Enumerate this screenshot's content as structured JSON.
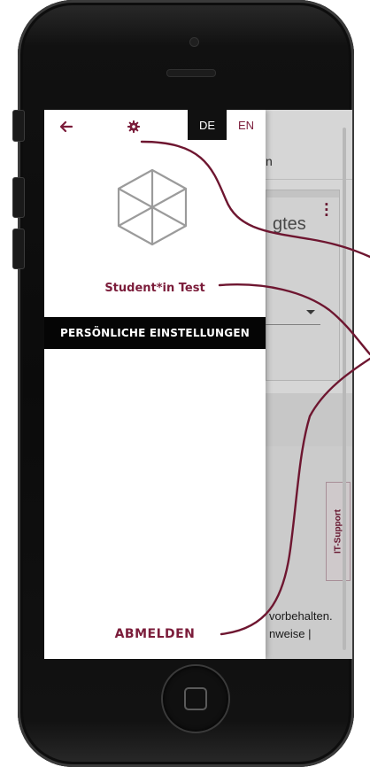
{
  "drawer": {
    "languages": {
      "de": "DE",
      "en": "EN",
      "active": "DE"
    },
    "user_name": "Student*in Test",
    "settings_label": "PERSÖNLICHE EINSTELLUNGEN",
    "logout_label": "ABMELDEN",
    "icons": {
      "back": "arrow-left-icon",
      "settings": "gear-icon",
      "avatar": "cube-logo-icon"
    }
  },
  "background_page": {
    "nav_text_fragment": "n",
    "card_title_fragment": "gtes",
    "support_label": "IT-Support",
    "footer_line_1": "vorbehalten.",
    "footer_line_2": "nweise |"
  },
  "colors": {
    "accent": "#7b1c3a",
    "bar_black": "#050505",
    "phone_body": "#111111"
  }
}
